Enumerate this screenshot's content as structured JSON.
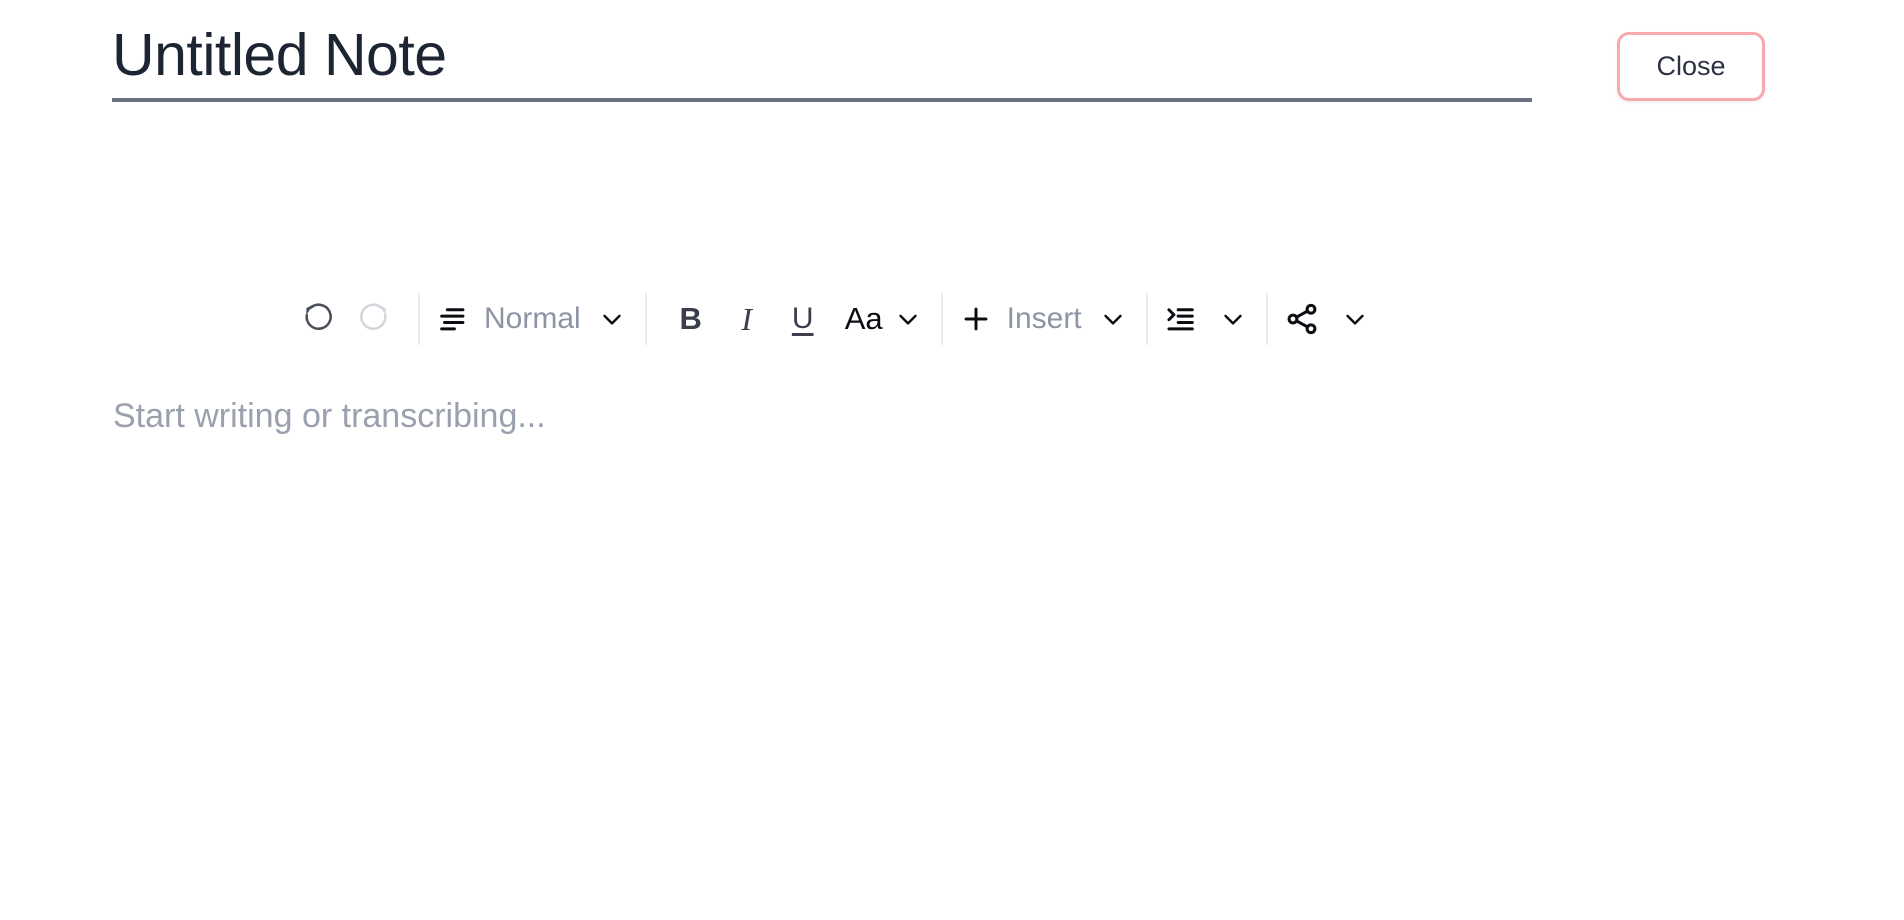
{
  "window": {
    "background_color": "#ffffff"
  },
  "header": {
    "title": "Untitled Note",
    "title_color": "#1d2433",
    "title_underline_color": "#6b7180",
    "close_button": {
      "label": "Close",
      "border_color": "#f7a9ac",
      "text_color": "#2b3241",
      "background_color": "#ffffff"
    }
  },
  "toolbar": {
    "divider_color": "#ececef",
    "groups": [
      {
        "name": "history",
        "items": [
          {
            "icon": "undo-icon",
            "label": "",
            "state": "enabled",
            "color": "#4a4f5c"
          },
          {
            "icon": "redo-icon",
            "label": "",
            "state": "disabled",
            "color": "#d3d6dd"
          }
        ]
      },
      {
        "name": "block-style",
        "items": [
          {
            "icon": "paragraph-align-icon",
            "label": "Normal",
            "state": "enabled",
            "color": "#0b0d12",
            "has_chevron": true
          }
        ]
      },
      {
        "name": "text-format",
        "items": [
          {
            "icon": "bold-icon",
            "label": "B",
            "state": "enabled",
            "color": "#3a3f4b"
          },
          {
            "icon": "italic-icon",
            "label": "I",
            "state": "enabled",
            "color": "#3a3f4b"
          },
          {
            "icon": "underline-icon",
            "label": "U",
            "state": "enabled",
            "color": "#3a3f4b"
          },
          {
            "icon": "font-size-icon",
            "label": "Aa",
            "state": "enabled",
            "color": "#0b0d12",
            "has_chevron": true
          }
        ]
      },
      {
        "name": "insert",
        "items": [
          {
            "icon": "plus-icon",
            "label": "Insert",
            "state": "enabled",
            "color": "#8d94a3",
            "has_chevron": true
          }
        ]
      },
      {
        "name": "indent",
        "items": [
          {
            "icon": "indent-increase-icon",
            "label": "",
            "state": "enabled",
            "color": "#0b0d12",
            "has_chevron": true
          }
        ]
      },
      {
        "name": "share",
        "items": [
          {
            "icon": "share-network-icon",
            "label": "",
            "state": "enabled",
            "color": "#0b0d12",
            "has_chevron": true
          }
        ]
      }
    ],
    "labels": {
      "block_style": "Normal",
      "bold": "B",
      "italic": "I",
      "underline": "U",
      "font_size": "Aa",
      "insert": "Insert"
    }
  },
  "editor": {
    "placeholder": "Start writing or transcribing...",
    "value": "",
    "placeholder_color": "#9aa0ae"
  }
}
